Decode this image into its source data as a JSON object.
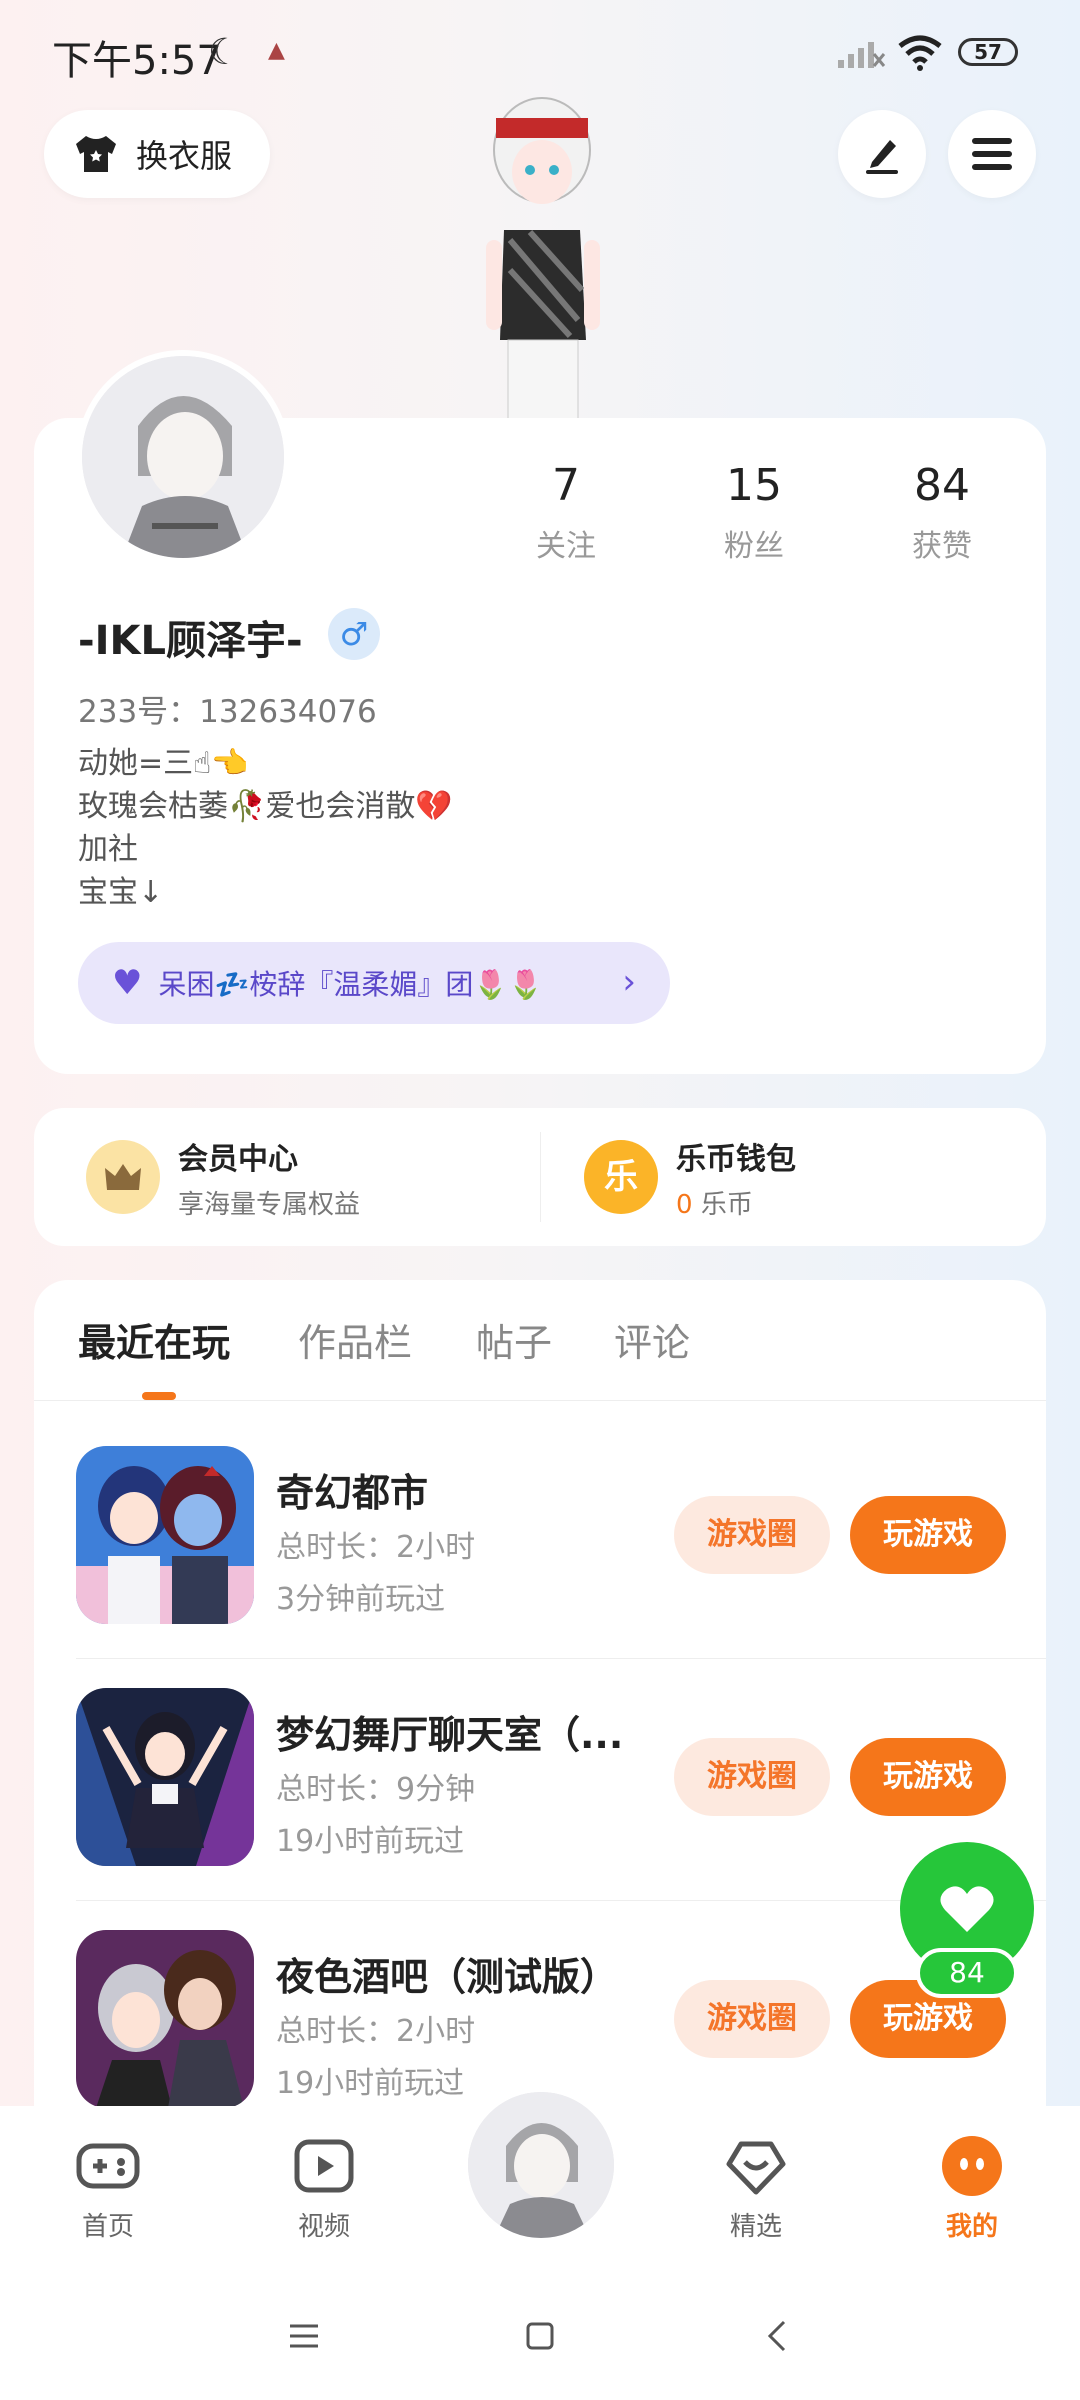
{
  "status_bar": {
    "time": "下午5:57",
    "battery": "57"
  },
  "header": {
    "wardrobe_label": "换衣服"
  },
  "profile": {
    "stats": [
      {
        "value": "7",
        "label": "关注"
      },
      {
        "value": "15",
        "label": "粉丝"
      },
      {
        "value": "84",
        "label": "获赞"
      }
    ],
    "username": "-IKL顾泽宇-",
    "gender_symbol": "♂",
    "uid": "233号：132634076",
    "bio": [
      "动她=三☝👈",
      "玫瑰会枯萎🥀爱也会消散💔",
      "加社",
      "宝宝↓"
    ],
    "club": "呆困💤桉辞『温柔媚』团🌷🌷"
  },
  "member": {
    "vip_title": "会员中心",
    "vip_sub": "享海量专属权益",
    "wallet_title": "乐币钱包",
    "wallet_icon_text": "乐",
    "wallet_amount": "0",
    "wallet_unit": "乐币"
  },
  "tabs": [
    "最近在玩",
    "作品栏",
    "帖子",
    "评论"
  ],
  "games": [
    {
      "name": "奇幻都市",
      "duration": "总时长：2小时",
      "last_played": "3分钟前玩过"
    },
    {
      "name": "梦幻舞厅聊天室（...",
      "duration": "总时长：9分钟",
      "last_played": "19小时前玩过"
    },
    {
      "name": "夜色酒吧（测试版）",
      "duration": "总时长：2小时",
      "last_played": "19小时前玩过"
    }
  ],
  "game_buttons": {
    "circle": "游戏圈",
    "play": "玩游戏"
  },
  "like_count": "84",
  "bottom_nav": [
    "首页",
    "视频",
    "精选",
    "我的"
  ],
  "colors": {
    "accent": "#f5761a",
    "like": "#26c63a",
    "club": "#6a52d8"
  }
}
